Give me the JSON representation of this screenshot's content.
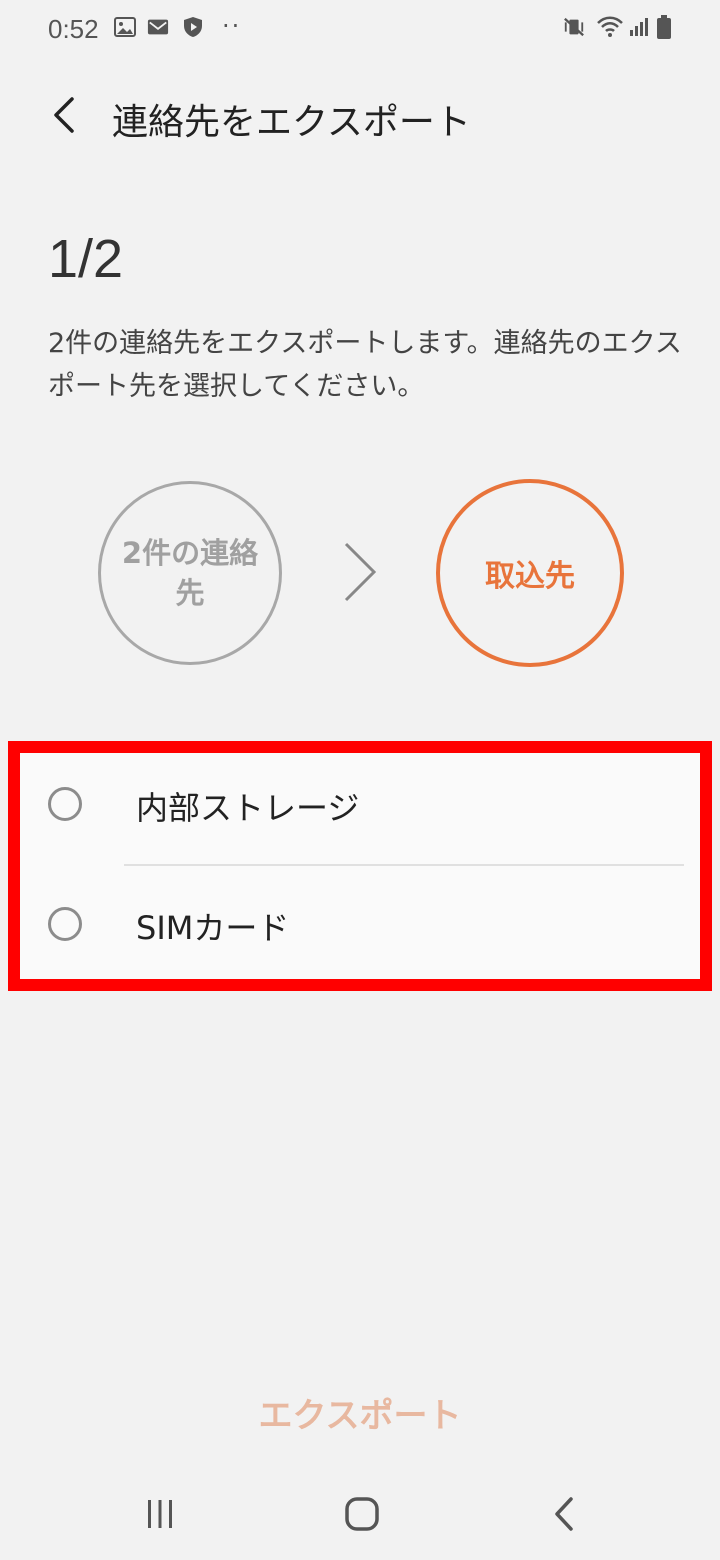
{
  "status_bar": {
    "time": "0:52",
    "overflow_dots": "··",
    "left_icons": [
      "image-icon",
      "mail-icon",
      "shield-icon"
    ],
    "right_icons": [
      "vibrate-mute-icon",
      "wifi-icon",
      "signal-icon",
      "battery-icon"
    ]
  },
  "header": {
    "title": "連絡先をエクスポート",
    "back_icon": "back-arrow-icon"
  },
  "step": "1/2",
  "description": "2件の連絡先をエクスポートします。連絡先のエクスポート先を選択してください。",
  "flow": {
    "source_label": "2件の連絡先",
    "target_label": "取込先",
    "arrow_icon": "chevron-right-icon"
  },
  "options": [
    {
      "label": "内部ストレージ",
      "selected": false
    },
    {
      "label": "SIMカード",
      "selected": false
    }
  ],
  "export_button": {
    "label": "エクスポート",
    "enabled": false
  },
  "nav_bar": {
    "recents_icon": "recents-icon",
    "home_icon": "home-icon",
    "back_icon": "back-icon"
  },
  "colors": {
    "background": "#f2f2f2",
    "accent": "#e8743b",
    "disabled_accent": "#e8b8a0",
    "highlight_border": "#ff0000",
    "muted_circle": "#a8a8a8"
  }
}
